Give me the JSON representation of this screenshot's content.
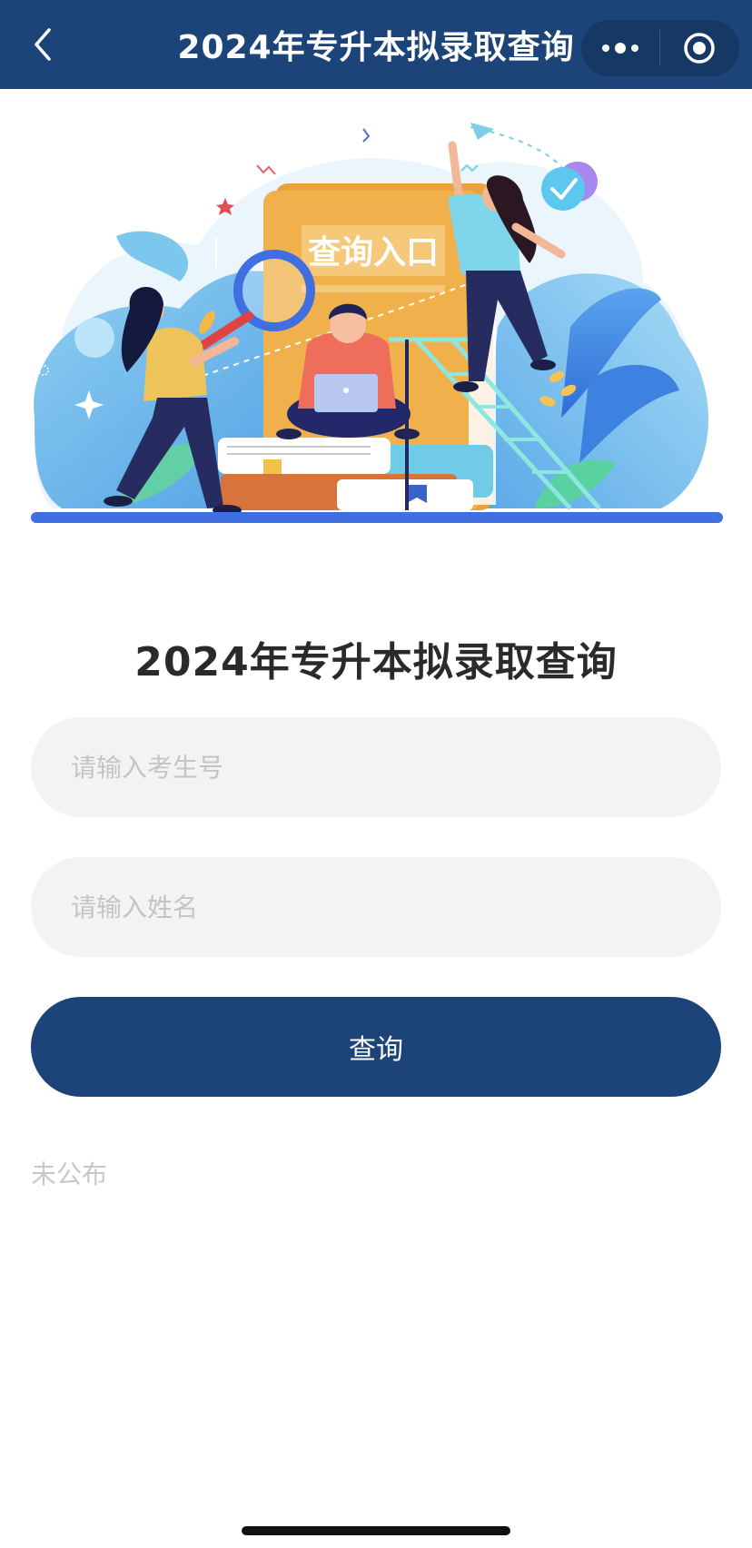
{
  "navbar": {
    "title": "2024年专升本拟录取查询",
    "back_icon": "chevron-left-icon",
    "more_icon": "more-dots-icon",
    "close_icon": "target-circle-icon"
  },
  "banner": {
    "sign_text": "查询入口"
  },
  "main": {
    "title": "2024年专升本拟录取查询",
    "exam_number_placeholder": "请输入考生号",
    "name_placeholder": "请输入姓名",
    "query_button_label": "查询",
    "status_text": "未公布"
  },
  "colors": {
    "primary": "#1d4479",
    "input_bg": "#f3f3f3",
    "placeholder": "#c4c4c4"
  }
}
